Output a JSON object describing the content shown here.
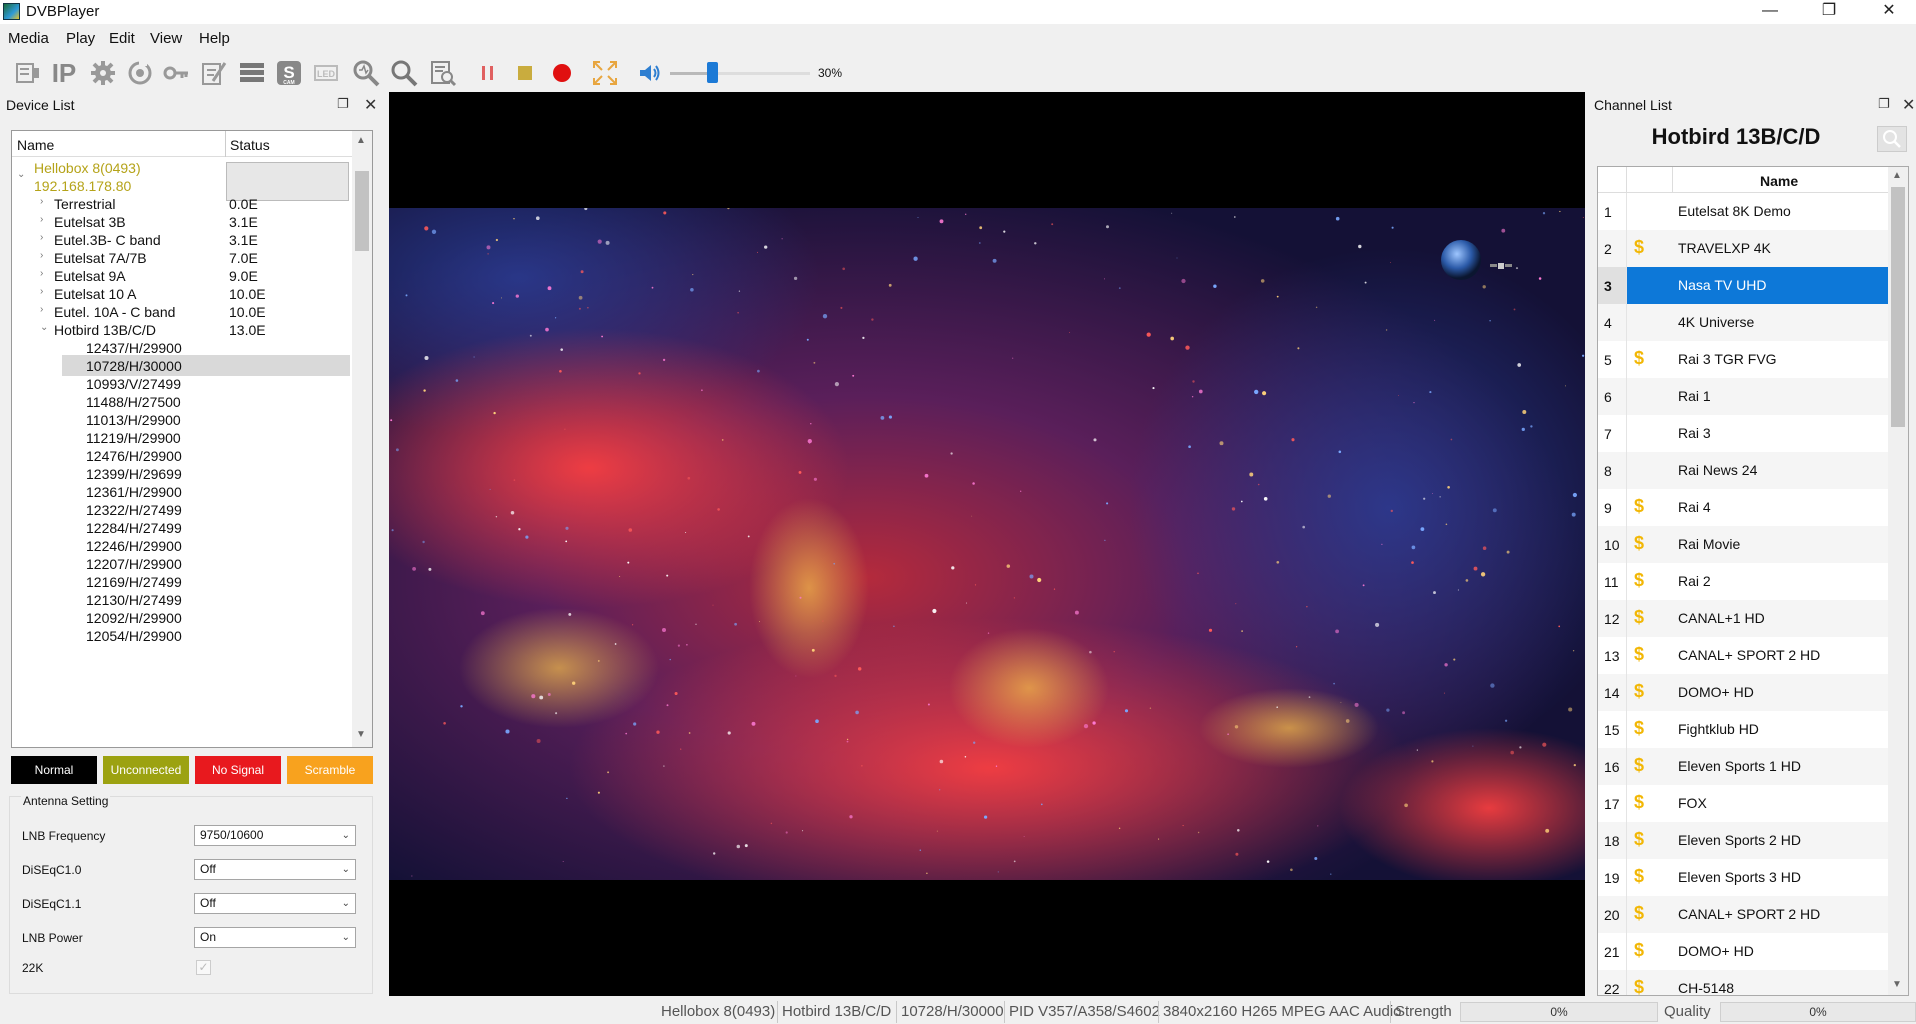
{
  "window": {
    "title": "DVBPlayer"
  },
  "menu": [
    "Media",
    "Play",
    "Edit",
    "View",
    "Help"
  ],
  "toolbar": {
    "ip_label": "IP",
    "volume_text": "30%",
    "volume_level": 0.3
  },
  "device_list": {
    "title": "Device List",
    "col_name": "Name",
    "col_status": "Status",
    "device_name": "Hellobox 8(0493)",
    "device_ip": "192.168.178.80",
    "satellites": [
      {
        "name": "Terrestrial",
        "status": "0.0E"
      },
      {
        "name": "Eutelsat 3B",
        "status": "3.1E"
      },
      {
        "name": "Eutel.3B- C band",
        "status": "3.1E"
      },
      {
        "name": "Eutelsat 7A/7B",
        "status": "7.0E"
      },
      {
        "name": "Eutelsat 9A",
        "status": "9.0E"
      },
      {
        "name": "Eutelsat 10 A",
        "status": "10.0E"
      },
      {
        "name": "Eutel. 10A - C band",
        "status": "10.0E"
      },
      {
        "name": "Hotbird 13B/C/D",
        "status": "13.0E"
      }
    ],
    "transponders": [
      "12437/H/29900",
      "10728/H/30000",
      "10993/V/27499",
      "11488/H/27500",
      "11013/H/29900",
      "11219/H/29900",
      "12476/H/29900",
      "12399/H/29699",
      "12361/H/29900",
      "12322/H/27499",
      "12284/H/27499",
      "12246/H/29900",
      "12207/H/29900",
      "12169/H/27499",
      "12130/H/27499",
      "12092/H/29900",
      "12054/H/29900"
    ]
  },
  "legend": {
    "normal": "Normal",
    "unconnected": "Unconnected",
    "no_signal": "No Signal",
    "scramble": "Scramble"
  },
  "antenna": {
    "title": "Antenna Setting",
    "lnb_frequency_label": "LNB Frequency",
    "lnb_frequency_value": "9750/10600",
    "diseqc10_label": "DiSEqC1.0",
    "diseqc10_value": "Off",
    "diseqc11_label": "DiSEqC1.1",
    "diseqc11_value": "Off",
    "lnb_power_label": "LNB Power",
    "lnb_power_value": "On",
    "k22_label": "22K"
  },
  "channel_list": {
    "title": "Channel List",
    "satellite": "Hotbird 13B/C/D",
    "col_name": "Name",
    "selected_index": 2,
    "channels": [
      {
        "num": "1",
        "name": "Eutelsat 8K Demo",
        "scrambled": false
      },
      {
        "num": "2",
        "name": "TRAVELXP 4K",
        "scrambled": true
      },
      {
        "num": "3",
        "name": "Nasa TV UHD",
        "scrambled": false
      },
      {
        "num": "4",
        "name": "4K  Universe",
        "scrambled": false
      },
      {
        "num": "5",
        "name": "Rai 3 TGR FVG",
        "scrambled": true
      },
      {
        "num": "6",
        "name": "Rai 1",
        "scrambled": false
      },
      {
        "num": "7",
        "name": "Rai 3",
        "scrambled": false
      },
      {
        "num": "8",
        "name": "Rai News 24",
        "scrambled": false
      },
      {
        "num": "9",
        "name": "Rai 4",
        "scrambled": true
      },
      {
        "num": "10",
        "name": "Rai Movie",
        "scrambled": true
      },
      {
        "num": "11",
        "name": "Rai 2",
        "scrambled": true
      },
      {
        "num": "12",
        "name": "CANAL+1 HD",
        "scrambled": true
      },
      {
        "num": "13",
        "name": "CANAL+ SPORT 2 HD",
        "scrambled": true
      },
      {
        "num": "14",
        "name": "DOMO+ HD",
        "scrambled": true
      },
      {
        "num": "15",
        "name": "Fightklub HD",
        "scrambled": true
      },
      {
        "num": "16",
        "name": "Eleven Sports 1 HD",
        "scrambled": true
      },
      {
        "num": "17",
        "name": "FOX",
        "scrambled": true
      },
      {
        "num": "18",
        "name": "Eleven Sports 2 HD",
        "scrambled": true
      },
      {
        "num": "19",
        "name": "Eleven Sports 3 HD",
        "scrambled": true
      },
      {
        "num": "20",
        "name": "CANAL+ SPORT 2 HD",
        "scrambled": true
      },
      {
        "num": "21",
        "name": "DOMO+ HD",
        "scrambled": true
      },
      {
        "num": "22",
        "name": "CH-5148",
        "scrambled": true
      }
    ]
  },
  "statusbar": {
    "device": "Hellobox 8(0493)",
    "satellite": "Hotbird 13B/C/D",
    "transponder": "10728/H/30000",
    "pid": "PID V357/A358/S4602",
    "stream": "3840x2160 H265 MPEG AAC Audio",
    "strength_label": "Strength",
    "strength_value": "0%",
    "quality_label": "Quality",
    "quality_value": "0%"
  },
  "colors": {
    "accent": "#0d78d8",
    "device_text": "#b5a319",
    "normal": "#000000",
    "unconnected": "#9ca211",
    "no_signal": "#e8191e",
    "scramble": "#f8a21e",
    "coin": "#f2b705"
  }
}
